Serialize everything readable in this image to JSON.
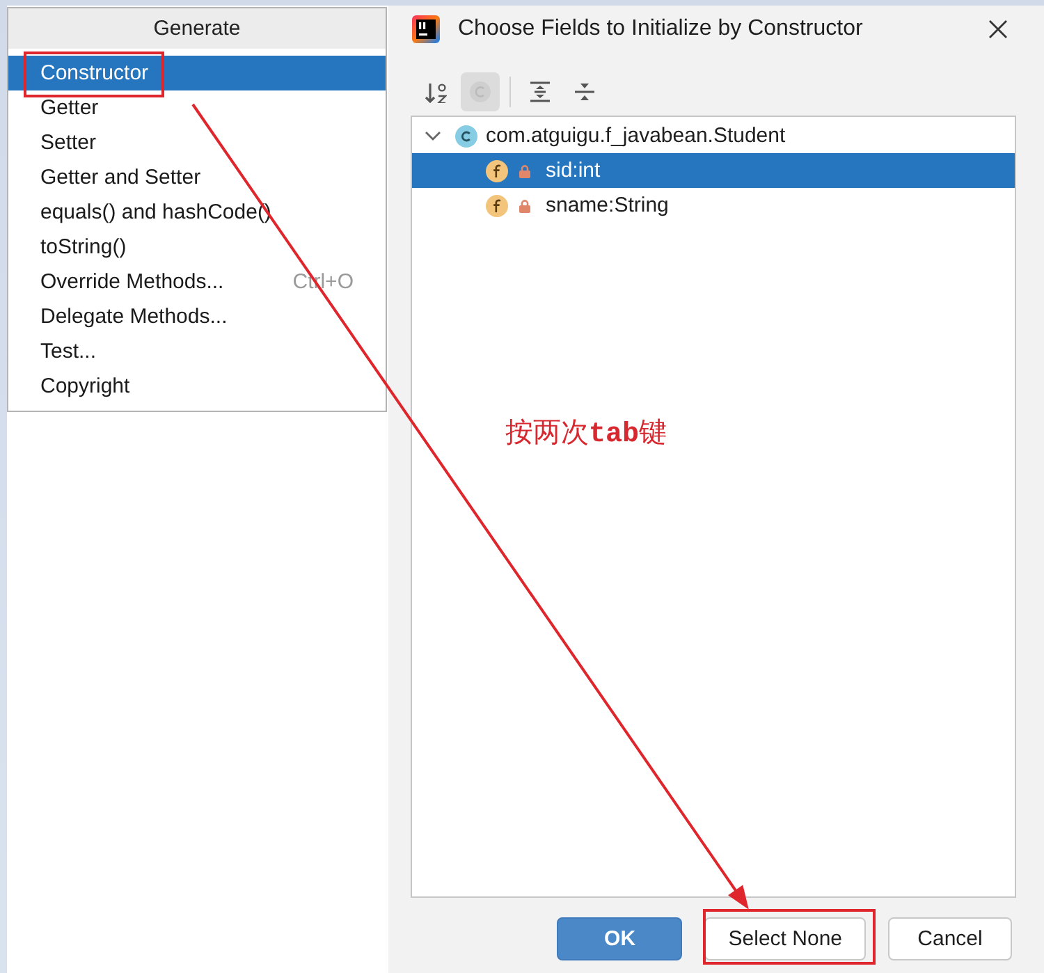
{
  "generate_menu": {
    "title": "Generate",
    "items": [
      {
        "label": "Constructor",
        "selected": true,
        "marked": true
      },
      {
        "label": "Getter",
        "selected": false,
        "marked": false
      },
      {
        "label": "Setter",
        "selected": false,
        "marked": false
      },
      {
        "label": "Getter and Setter",
        "selected": false,
        "marked": false
      },
      {
        "label": "equals() and hashCode()",
        "selected": false,
        "marked": false
      },
      {
        "label": "toString()",
        "selected": false,
        "marked": false
      },
      {
        "label": "Override Methods...",
        "shortcut": "Ctrl+O",
        "selected": false,
        "marked": false
      },
      {
        "label": "Delegate Methods...",
        "selected": false,
        "marked": false
      },
      {
        "label": "Test...",
        "selected": false,
        "marked": false
      },
      {
        "label": "Copyright",
        "selected": false,
        "marked": false
      }
    ]
  },
  "dialog": {
    "title": "Choose Fields to Initialize by Constructor",
    "toolbar": [
      [
        {
          "kind": "sort",
          "pressed": false
        },
        {
          "kind": "classes",
          "pressed": true
        }
      ],
      [
        {
          "kind": "expand_all",
          "pressed": false
        },
        {
          "kind": "collapse_all",
          "pressed": false
        }
      ]
    ],
    "tree": {
      "kind": "class",
      "label": "com.atguigu.f_javabean.Student",
      "expanded": true,
      "selected": false,
      "children": [
        {
          "kind": "field",
          "private": true,
          "label": "sid:int",
          "selected": true
        },
        {
          "kind": "field",
          "private": true,
          "label": "sname:String",
          "selected": false
        }
      ]
    },
    "buttons": [
      {
        "label": "OK",
        "default": true,
        "marked": false
      },
      {
        "label": "Select None",
        "default": false,
        "marked": true
      },
      {
        "label": "Cancel",
        "default": false,
        "marked": false
      }
    ]
  },
  "annotation": {
    "note": "按两次**tab**键",
    "arrow": true
  }
}
